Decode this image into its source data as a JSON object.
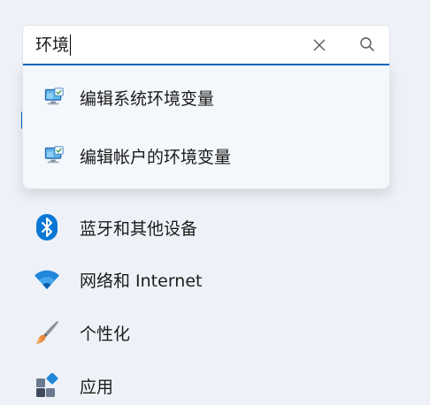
{
  "search": {
    "value": "环境",
    "clear_icon": "close-icon",
    "search_icon": "search-icon",
    "accent_color": "#0067c0"
  },
  "suggestions": [
    {
      "label": "编辑系统环境变量",
      "icon": "system-properties-icon"
    },
    {
      "label": "编辑帐户的环境变量",
      "icon": "system-properties-icon"
    }
  ],
  "nav": {
    "items": [
      {
        "label": "蓝牙和其他设备",
        "icon": "bluetooth-icon",
        "color": "#0a78d4"
      },
      {
        "label": "网络和 Internet",
        "icon": "wifi-icon",
        "color": "#1f86d9"
      },
      {
        "label": "个性化",
        "icon": "paintbrush-icon",
        "color": "#e8863a"
      },
      {
        "label": "应用",
        "icon": "apps-icon",
        "color": "#4a5a70"
      }
    ]
  }
}
